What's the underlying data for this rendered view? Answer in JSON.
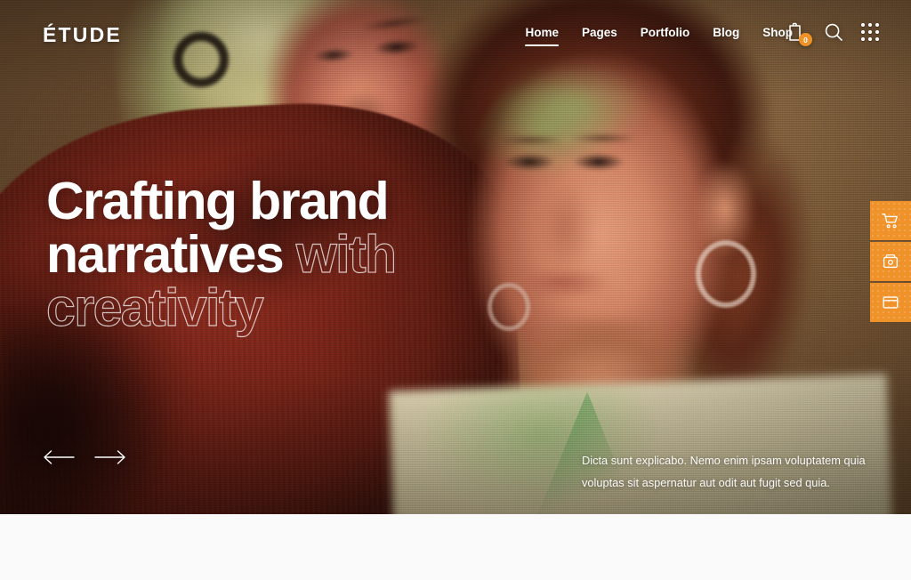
{
  "brand": {
    "name": "ÉTUDE"
  },
  "nav": {
    "items": [
      {
        "label": "Home",
        "active": true
      },
      {
        "label": "Pages",
        "active": false
      },
      {
        "label": "Portfolio",
        "active": false
      },
      {
        "label": "Blog",
        "active": false
      },
      {
        "label": "Shop",
        "active": false
      }
    ]
  },
  "header_icons": {
    "cart": {
      "name": "cart-icon",
      "badge_count": "0"
    },
    "search": {
      "name": "search-icon"
    },
    "grid": {
      "name": "grid-menu-icon"
    }
  },
  "hero": {
    "headline": {
      "line1_solid": "Crafting brand",
      "line2_solid": "narratives ",
      "line2_outline": "with",
      "line3_outline": "creativity"
    },
    "description": "Dicta sunt explicabo. Nemo enim ipsam voluptatem quia voluptas sit aspernatur aut odit aut fugit sed quia.",
    "slider": {
      "prev_label": "Previous slide",
      "next_label": "Next slide"
    }
  },
  "side_buttons": [
    {
      "name": "shopping-cart-icon",
      "label": "Cart"
    },
    {
      "name": "purchase-icon",
      "label": "Purchase"
    },
    {
      "name": "layout-window-icon",
      "label": "Layouts"
    }
  ],
  "colors": {
    "accent_orange": "#f0922a",
    "badge_orange": "#ef9226",
    "text_white": "#ffffff",
    "page_background": "#fafafa",
    "hero_backdrop_brown": "#7d5b38",
    "sweater_red": "#7a2316"
  }
}
